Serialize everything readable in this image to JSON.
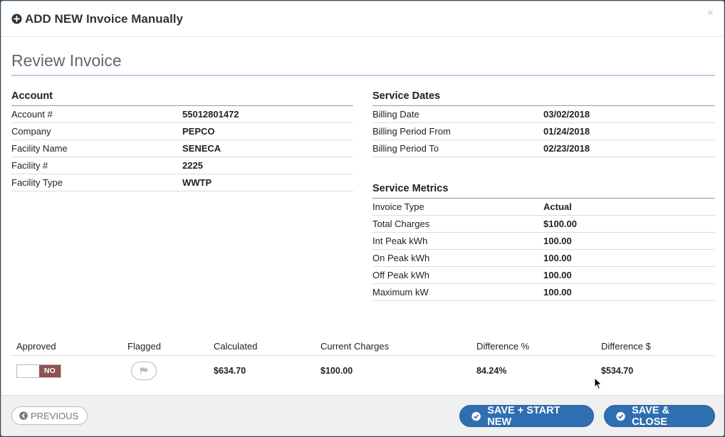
{
  "modal": {
    "title": "ADD NEW Invoice Manually",
    "close": "×",
    "review_title": "Review Invoice"
  },
  "account": {
    "heading": "Account",
    "rows": [
      {
        "label": "Account #",
        "value": "55012801472"
      },
      {
        "label": "Company",
        "value": "PEPCO"
      },
      {
        "label": "Facility Name",
        "value": "SENECA"
      },
      {
        "label": "Facility #",
        "value": "2225"
      },
      {
        "label": "Facility Type",
        "value": "WWTP"
      }
    ]
  },
  "service_dates": {
    "heading": "Service Dates",
    "rows": [
      {
        "label": "Billing Date",
        "value": "03/02/2018"
      },
      {
        "label": "Billing Period From",
        "value": "01/24/2018"
      },
      {
        "label": "Billing Period To",
        "value": "02/23/2018"
      }
    ]
  },
  "service_metrics": {
    "heading": "Service Metrics",
    "rows": [
      {
        "label": "Invoice Type",
        "value": "Actual"
      },
      {
        "label": "Total Charges",
        "value": "$100.00"
      },
      {
        "label": "Int Peak kWh",
        "value": "100.00"
      },
      {
        "label": "On Peak kWh",
        "value": "100.00"
      },
      {
        "label": "Off Peak kWh",
        "value": "100.00"
      },
      {
        "label": "Maximum kW",
        "value": "100.00"
      }
    ]
  },
  "summary": {
    "headers": {
      "approved": "Approved",
      "flagged": "Flagged",
      "calculated": "Calculated",
      "current_charges": "Current Charges",
      "difference_pct": "Difference %",
      "difference_usd": "Difference $"
    },
    "values": {
      "approved_toggle": "NO",
      "calculated": "$634.70",
      "current_charges": "$100.00",
      "difference_pct": "84.24%",
      "difference_usd": "$534.70"
    }
  },
  "footer": {
    "previous": "PREVIOUS",
    "save_start_new": "SAVE + START NEW",
    "save_close": "SAVE & CLOSE"
  },
  "colors": {
    "primary": "#2f6eb0",
    "toggle_no": "#8f5151"
  }
}
